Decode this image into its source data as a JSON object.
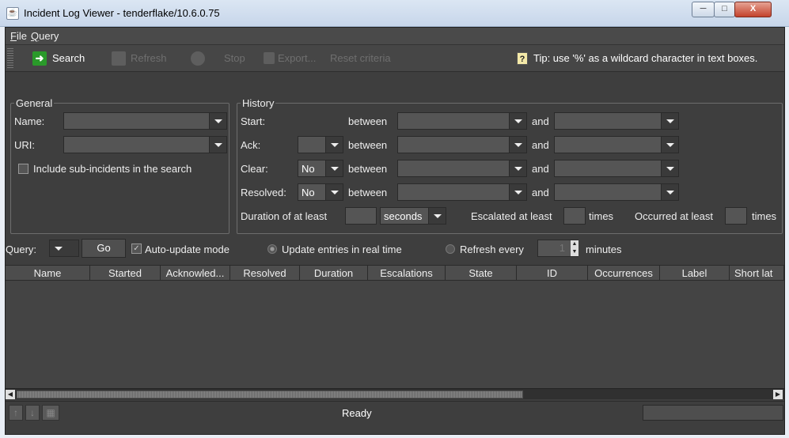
{
  "window": {
    "title": "Incident Log Viewer - tenderflake/10.6.0.75"
  },
  "menu": [
    "File",
    "Query"
  ],
  "toolbar": {
    "search": "Search",
    "refresh": "Refresh",
    "stop": "Stop",
    "export": "Export...",
    "reset": "Reset criteria",
    "tip": "Tip: use '%' as a wildcard character in text boxes."
  },
  "general": {
    "legend": "General",
    "name_label": "Name:",
    "uri_label": "URI:",
    "include_sub": "Include sub-incidents in the search"
  },
  "history": {
    "legend": "History",
    "start": "Start:",
    "ack": "Ack:",
    "clear": "Clear:",
    "resolved": "Resolved:",
    "between": "between",
    "and": "and",
    "clear_value": "No",
    "resolved_value": "No",
    "duration_label": "Duration of at least",
    "duration_unit": "seconds",
    "escalated_label": "Escalated at least",
    "times": "times",
    "occurred_label": "Occurred at least"
  },
  "query": {
    "label": "Query:",
    "go": "Go",
    "auto_update": "Auto-update mode",
    "update_realtime": "Update entries in real time",
    "refresh_every": "Refresh every",
    "refresh_value": "1",
    "minutes": "minutes"
  },
  "table": {
    "columns": [
      "Name",
      "Started",
      "Acknowled...",
      "Resolved",
      "Duration",
      "Escalations",
      "State",
      "ID",
      "Occurrences",
      "Label",
      "Short lat"
    ]
  },
  "status": {
    "text": "Ready"
  },
  "colors": {
    "accent_green": "#2a9a2a",
    "panel_bg": "#3e3e3e"
  }
}
